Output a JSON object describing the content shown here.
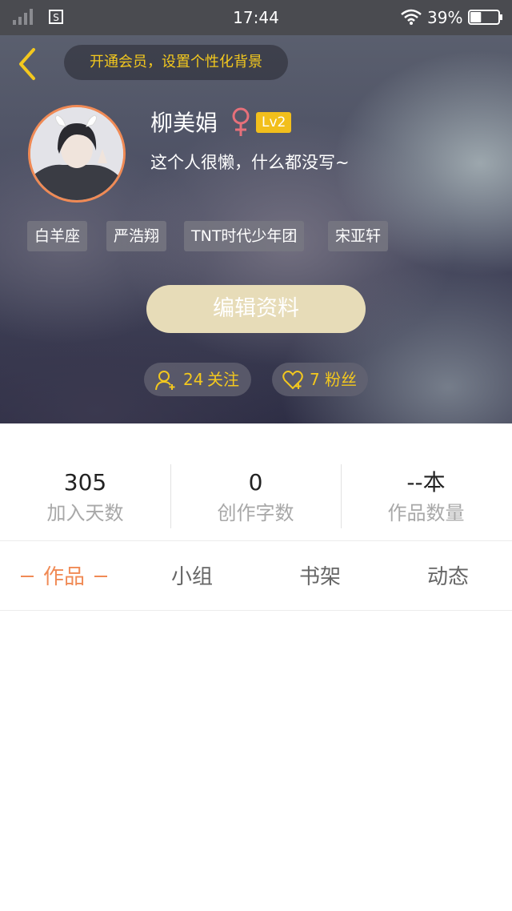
{
  "status_bar": {
    "time": "17:44",
    "battery_percent": "39%",
    "battery_level": 0.39,
    "icons": [
      "signal-icon",
      "sim-icon",
      "wifi-icon",
      "battery-icon"
    ]
  },
  "header": {
    "back_icon": "chevron-left-icon",
    "vip_banner": "开通会员，设置个性化背景",
    "username": "柳美娟",
    "gender_icon": "female-icon",
    "level": "Lv2",
    "bio": "这个人很懒，什么都没写~",
    "tags": [
      "白羊座",
      "严浩翔",
      "TNT时代少年团",
      "宋亚轩"
    ],
    "edit_button": "编辑资料",
    "following": {
      "count": "24",
      "label": "关注",
      "icon": "add-user-icon"
    },
    "followers": {
      "count": "7",
      "label": "粉丝",
      "icon": "heart-icon"
    }
  },
  "stats": [
    {
      "value": "305",
      "label": "加入天数"
    },
    {
      "value": "0",
      "label": "创作字数"
    },
    {
      "value": "--本",
      "label": "作品数量"
    }
  ],
  "tabs": [
    {
      "label": "作品",
      "active": true
    },
    {
      "label": "小组",
      "active": false
    },
    {
      "label": "书架",
      "active": false
    },
    {
      "label": "动态",
      "active": false
    }
  ],
  "colors": {
    "accent": "#f08a55",
    "gold": "#f3c81e",
    "level_badge": "#f2bf1c",
    "edit_button": "#e7dcb8",
    "gender": "#e7707a"
  }
}
